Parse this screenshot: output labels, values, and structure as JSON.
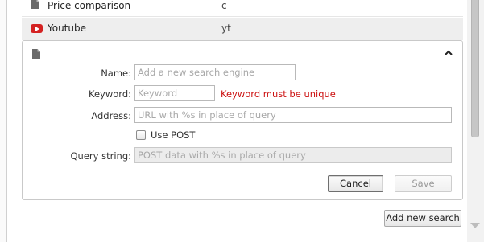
{
  "engines": [
    {
      "name": "Price comparison",
      "keyword": "c",
      "icon": "document-icon"
    },
    {
      "name": "Youtube",
      "keyword": "yt",
      "icon": "youtube-icon"
    }
  ],
  "editor": {
    "icon": "document-icon",
    "collapse_icon": "chevron-up-icon",
    "name_label": "Name:",
    "name_placeholder": "Add a new search engine",
    "keyword_label": "Keyword:",
    "keyword_placeholder": "Keyword",
    "keyword_error": "Keyword must be unique",
    "address_label": "Address:",
    "address_placeholder": "URL with %s in place of query",
    "use_post_label": "Use POST",
    "use_post_checked": false,
    "query_label": "Query string:",
    "query_placeholder": "POST data with %s in place of query",
    "cancel_label": "Cancel",
    "save_label": "Save"
  },
  "footer": {
    "add_label": "Add new search"
  },
  "colors": {
    "error": "#cc1111",
    "youtube": "#d42222",
    "selected_row": "#eeeeee"
  }
}
